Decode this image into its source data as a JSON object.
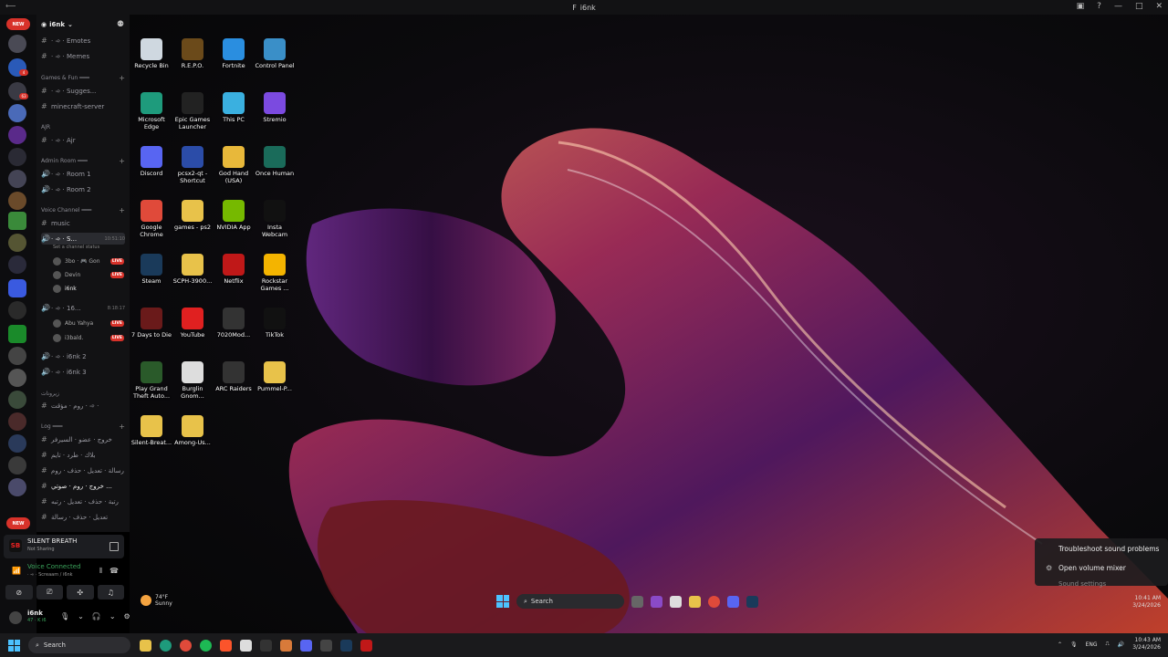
{
  "window": {
    "title": "i6nk"
  },
  "server": {
    "name": "i6nk"
  },
  "channels": {
    "emotes": "· ➾ · Emotes",
    "memes": "· ➾ · Memes",
    "cat_games": "Games & Fun ═══",
    "suggest": "· ➾ · Sugges...",
    "minecraft": "minecraft-server",
    "cat_ajr": "AJR",
    "ajr": "· ➾ · Ajr",
    "cat_admin": "Admin Room ═══",
    "room1": "· ➾ · Room 1",
    "room2": "· ➾ · Room 2",
    "cat_voice": "Voice Channel ═══",
    "music": "music",
    "active_voice": "· ➾ · S...",
    "active_voice_time": "10:51:10",
    "set_status": "Set a channel status",
    "users1": [
      {
        "name": "3bo · 🎮 Gon",
        "live": "LIVE"
      },
      {
        "name": "Devin",
        "live": "LIVE"
      },
      {
        "name": "i6nk",
        "live": ""
      }
    ],
    "vc2": "· ➾ · 16...",
    "vc2_time": "8:18:17",
    "users2": [
      {
        "name": "Abu Yahya",
        "live": "LIVE"
      },
      {
        "name": "i3bald.",
        "live": "LIVE"
      }
    ],
    "vc3": "· ➾ · i6nk 2",
    "vc4": "· ➾ · i6nk 3",
    "cat_rooms": "زيرونات",
    "rooms_ch": "روم · مؤقت · ➾ ·",
    "cat_log": "Log ═══",
    "log1": "خروج · عضو · السيرفر",
    "log2": "بلاك · طرد · تايم",
    "log3": "رسالة · تعديل · حذف · روم",
    "log4": "خروج · روم · صوتي ...",
    "log5": "رتبة · حذف · تعديل · رتبه",
    "log6": "تعديل · حذف · رسالة"
  },
  "activity": {
    "name": "SILENT BREATH",
    "status": "Not Sharing"
  },
  "voice": {
    "status": "Voice Connected",
    "detail": "· ➾ · Screaam / i6nk"
  },
  "user": {
    "name": "i6nk",
    "status": "47 · K i6"
  },
  "desktop_icons": [
    {
      "label": "Recycle Bin",
      "color": "#cfd8e0"
    },
    {
      "label": "R.E.P.O.",
      "color": "#6b4a1a"
    },
    {
      "label": "Fortnite",
      "color": "#2a8ee0"
    },
    {
      "label": "Control Panel",
      "color": "#3a8fc8"
    },
    {
      "label": "Microsoft Edge",
      "color": "#1e9b7c"
    },
    {
      "label": "Epic Games Launcher",
      "color": "#222222"
    },
    {
      "label": "This PC",
      "color": "#3ab0e0"
    },
    {
      "label": "Stremio",
      "color": "#7b4ae0"
    },
    {
      "label": "Discord",
      "color": "#5865f2"
    },
    {
      "label": "pcsx2-qt - Shortcut",
      "color": "#2b4ca8"
    },
    {
      "label": "God Hand (USA)",
      "color": "#e8b83a"
    },
    {
      "label": "Once Human",
      "color": "#1a6b5a"
    },
    {
      "label": "Google Chrome",
      "color": "#e04a3a"
    },
    {
      "label": "games - ps2",
      "color": "#e8c24a"
    },
    {
      "label": "NVIDIA App",
      "color": "#76b900"
    },
    {
      "label": "Insta Webcam",
      "color": "#111111"
    },
    {
      "label": "Steam",
      "color": "#1a3a5a"
    },
    {
      "label": "SCPH-3900...",
      "color": "#e8c24a"
    },
    {
      "label": "Netflix",
      "color": "#c01818"
    },
    {
      "label": "Rockstar Games ...",
      "color": "#f4b400"
    },
    {
      "label": "7 Days to Die",
      "color": "#6a1a1a"
    },
    {
      "label": "YouTube",
      "color": "#e02020"
    },
    {
      "label": "7020Mod...",
      "color": "#333333"
    },
    {
      "label": "TikTok",
      "color": "#111111"
    },
    {
      "label": "Play Grand Theft Auto...",
      "color": "#2a5a2a"
    },
    {
      "label": "Burglin Gnom...",
      "color": "#dddddd"
    },
    {
      "label": "ARC Raiders",
      "color": "#333333"
    },
    {
      "label": "Pummel-P...",
      "color": "#e8c24a"
    },
    {
      "label": "Silent-Breat...",
      "color": "#e8c24a"
    },
    {
      "label": "Among-Us...",
      "color": "#e8c24a"
    }
  ],
  "weather": {
    "temp": "74°F",
    "cond": "Sunny"
  },
  "inner_taskbar": {
    "search": "Search",
    "time": "10:41 AM",
    "date": "3/24/2026"
  },
  "context_menu": {
    "troubleshoot": "Troubleshoot sound problems",
    "mixer": "Open volume mixer",
    "settings": "Sound settings"
  },
  "taskbar": {
    "search": "Search",
    "lang": "ENG",
    "time": "10:43 AM",
    "date": "3/24/2026"
  }
}
